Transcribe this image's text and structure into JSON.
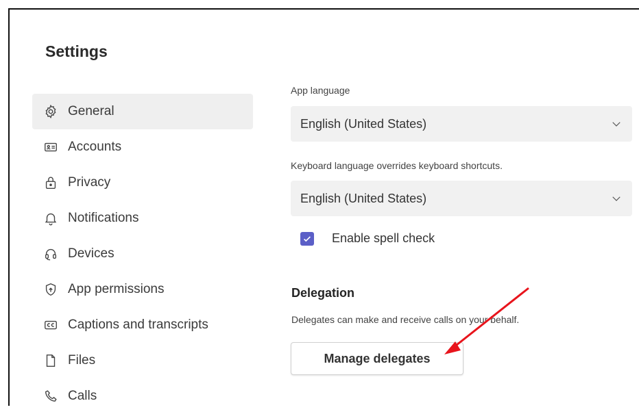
{
  "page": {
    "title": "Settings"
  },
  "sidebar": {
    "items": [
      {
        "label": "General",
        "icon": "gear-icon",
        "active": true
      },
      {
        "label": "Accounts",
        "icon": "id-card-icon",
        "active": false
      },
      {
        "label": "Privacy",
        "icon": "lock-icon",
        "active": false
      },
      {
        "label": "Notifications",
        "icon": "bell-icon",
        "active": false
      },
      {
        "label": "Devices",
        "icon": "headset-icon",
        "active": false
      },
      {
        "label": "App permissions",
        "icon": "shield-icon",
        "active": false
      },
      {
        "label": "Captions and transcripts",
        "icon": "closed-captions-icon",
        "active": false
      },
      {
        "label": "Files",
        "icon": "file-icon",
        "active": false
      },
      {
        "label": "Calls",
        "icon": "phone-icon",
        "active": false
      }
    ]
  },
  "general": {
    "app_language": {
      "label": "App language",
      "value": "English (United States)"
    },
    "keyboard_language": {
      "label": "Keyboard language overrides keyboard shortcuts.",
      "value": "English (United States)"
    },
    "spell_check": {
      "label": "Enable spell check",
      "checked": true
    }
  },
  "delegation": {
    "title": "Delegation",
    "description": "Delegates can make and receive calls on your behalf.",
    "button_label": "Manage delegates"
  },
  "colors": {
    "accent": "#5b5fc7",
    "annotation_arrow": "#e8141c",
    "active_nav_bg": "#efefef"
  }
}
